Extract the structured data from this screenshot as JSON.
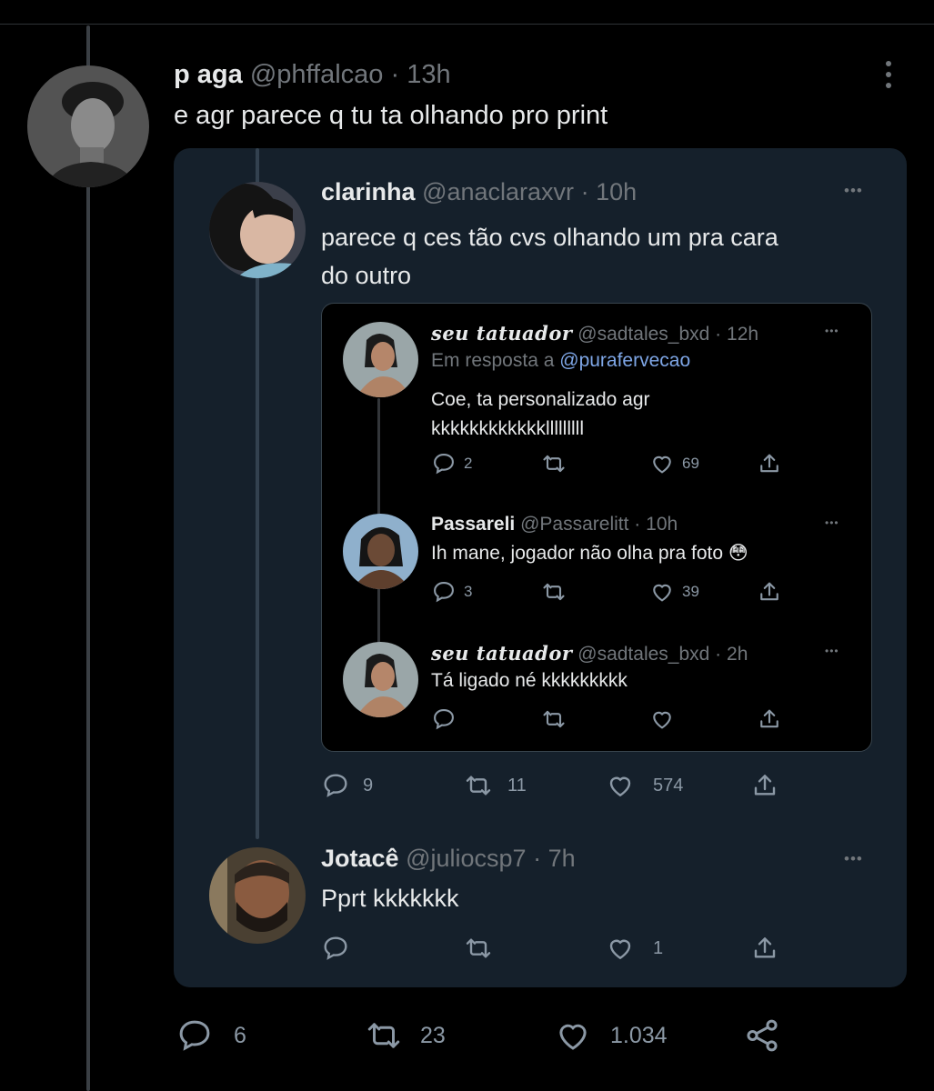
{
  "main_tweet": {
    "name": "p aga",
    "handle": "@phffalcao",
    "time": "13h",
    "text": "e agr parece q tu ta olhando pro print",
    "stats": {
      "replies": "6",
      "retweets": "23",
      "likes": "1.034"
    }
  },
  "quoted_thread": {
    "tweet1": {
      "name": "clarinha",
      "handle": "@anaclaraxvr",
      "time": "10h",
      "text_line1": "parece q ces tão cvs olhando um pra cara",
      "text_line2": "do outro",
      "stats": {
        "replies": "9",
        "retweets": "11",
        "likes": "574"
      }
    },
    "screenshot": {
      "t1": {
        "name": "seu tatuador",
        "handle": "@sadtales_bxd",
        "time": "12h",
        "reply_prefix": "Em resposta a",
        "reply_to": "@purafervecao",
        "text_line1": "Coe, ta personalizado agr",
        "text_line2": "kkkkkkkkkkkklllllllll",
        "stats": {
          "replies": "2",
          "likes": "69"
        }
      },
      "t2": {
        "name": "Passareli",
        "handle": "@Passarelitt",
        "time": "10h",
        "text": "Ih mane, jogador não olha pra foto 😳",
        "stats": {
          "replies": "3",
          "likes": "39"
        }
      },
      "t3": {
        "name": "seu tatuador",
        "handle": "@sadtales_bxd",
        "time": "2h",
        "text": "Tá ligado né kkkkkkkkk"
      }
    },
    "tweet2": {
      "name": "Jotacê",
      "handle": "@juliocsp7",
      "time": "7h",
      "text": "Pprt kkkkkkk",
      "stats": {
        "likes": "1"
      }
    }
  },
  "dot_sep": "·",
  "more_label": "•••",
  "icons": [
    "reply-icon",
    "retweet-icon",
    "like-icon",
    "share-icon",
    "more-vertical-icon",
    "more-horizontal-icon"
  ],
  "colors": {
    "background": "#000000",
    "card": "#15202b",
    "link": "#7ea6e6",
    "muted": "#71767b"
  }
}
